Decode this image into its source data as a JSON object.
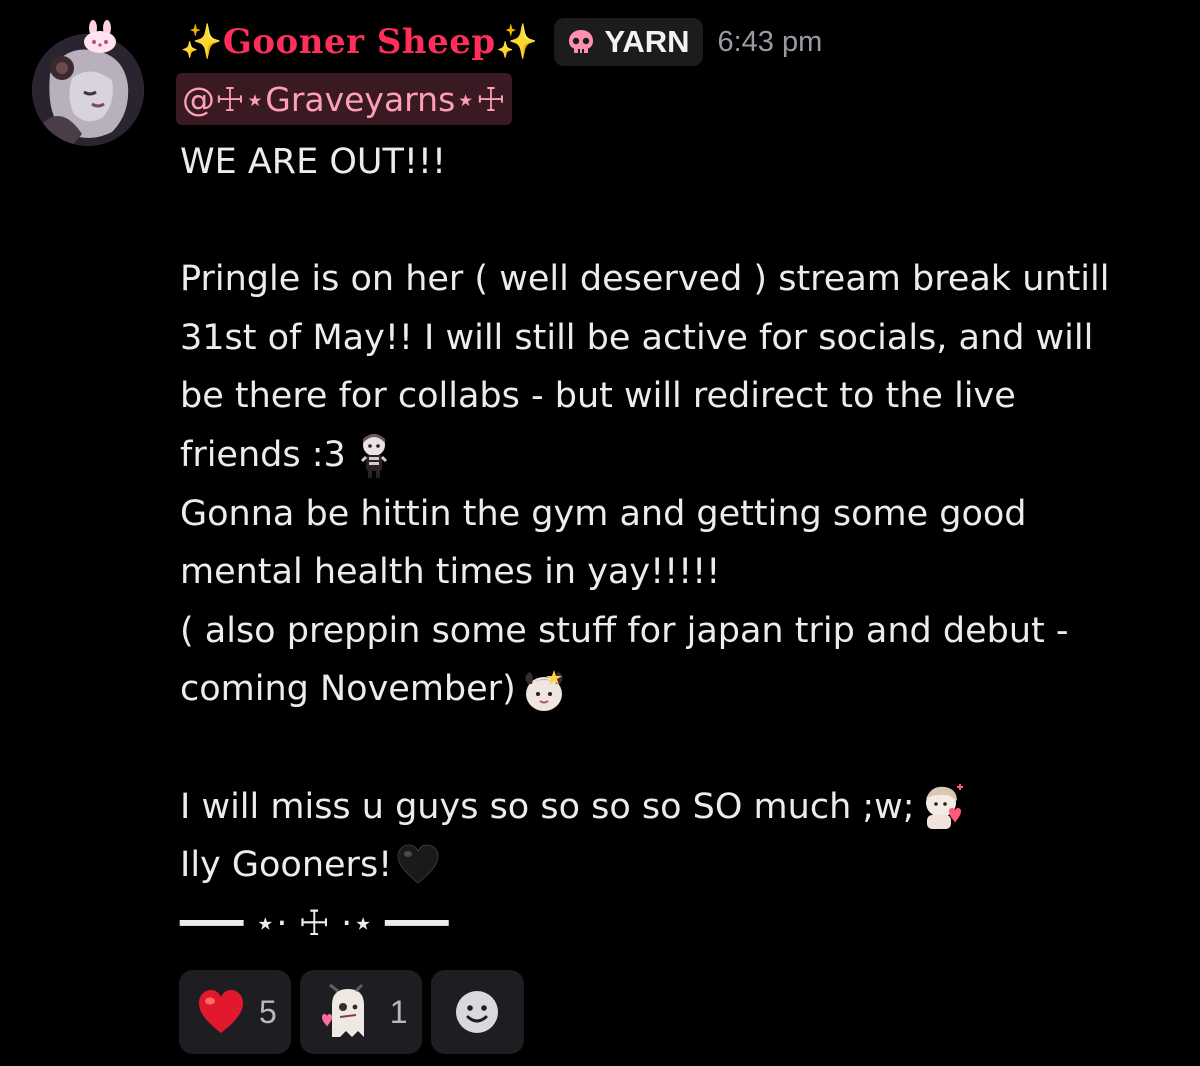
{
  "message": {
    "author": {
      "display_name": "✨Gooner Sheep✨",
      "tag": "YARN",
      "tag_icon": "skull-icon",
      "tag_icon_color": "#ff8fb1",
      "name_color": "#ff2e5b"
    },
    "timestamp": "6:43 pm",
    "mention": "@☩⋆Graveyarns⋆☩",
    "lines": [
      "WE ARE OUT!!!",
      "",
      "Pringle is on her ( well deserved ) stream break untill",
      "31st of May!! I will still be active for socials, and will",
      "be there for collabs - but will redirect to the live",
      "friends :3",
      "Gonna be hittin the gym and getting some good",
      "mental health times in yay!!!!!",
      "( also preppin some stuff for japan trip and debut -",
      "coming November)",
      "",
      "I will miss u guys so so so so SO much ;w;",
      "Ily Gooners!",
      "━━━ ⋆⋅ ☩ ⋅⋆ ━━━"
    ],
    "inline_emojis": {
      "line_5": "chibi-sticker-emoji",
      "line_9": "sheep-girl-sticker-emoji",
      "line_11": "hug-heart-sticker-emoji",
      "line_12": "black-heart-emoji"
    },
    "reactions": [
      {
        "emoji": "red-heart-emoji",
        "count": "5"
      },
      {
        "emoji": "ghost-plush-sticker-emoji",
        "count": "1"
      }
    ],
    "add_reaction_icon": "smiley-add-reaction-icon"
  },
  "colors": {
    "background": "#000000",
    "text": "#ececee",
    "mention_bg": "#3a1a22",
    "mention_text": "#ff9fb4",
    "timestamp": "#9a9aa2",
    "chip_bg": "#1e1e22"
  }
}
